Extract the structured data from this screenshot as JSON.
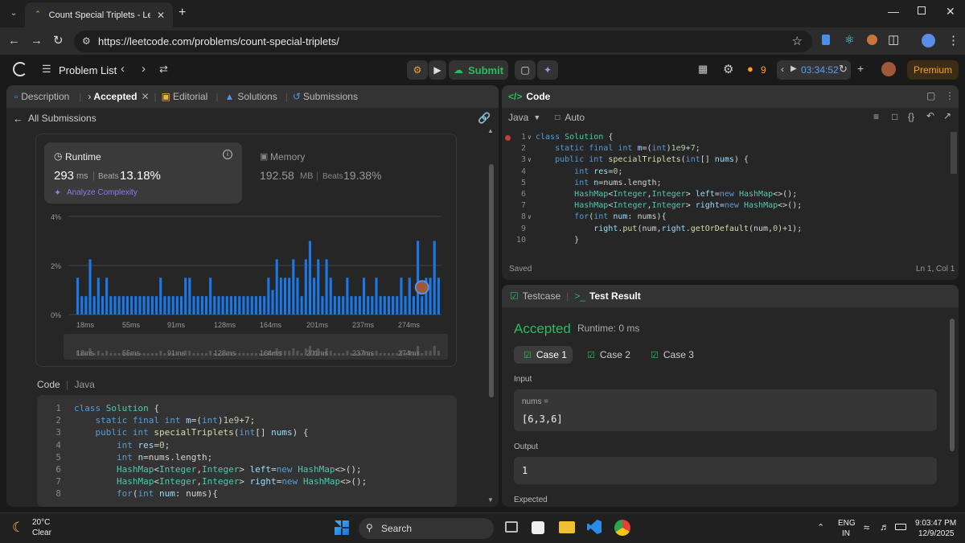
{
  "browser": {
    "tab_title": "Count Special Triplets - LeetCode",
    "url": "https://leetcode.com/problems/count-special-triplets/"
  },
  "nav": {
    "problem_list": "Problem List",
    "submit": "Submit",
    "streak": "9",
    "timer": "03:34:52",
    "premium": "Premium"
  },
  "left": {
    "tabs": [
      "Description",
      "Accepted",
      "Editorial",
      "Solutions",
      "Submissions"
    ],
    "back": "All Submissions",
    "runtime": {
      "label": "Runtime",
      "value": "293",
      "unit": "ms",
      "beats_label": "Beats",
      "beats": "13.18%",
      "analyze": "Analyze Complexity"
    },
    "memory": {
      "label": "Memory",
      "value": "192.58",
      "unit": "MB",
      "beats_label": "Beats",
      "beats": "19.38%"
    },
    "code_label": "Code",
    "lang": "Java"
  },
  "chart_data": {
    "type": "bar",
    "y_ticks": [
      "4%",
      "2%",
      "0%"
    ],
    "x_ticks": [
      "18ms",
      "55ms",
      "91ms",
      "128ms",
      "164ms",
      "201ms",
      "237ms",
      "274ms"
    ],
    "ylim": [
      0,
      4
    ],
    "values": [
      1.5,
      0.75,
      0.75,
      2.25,
      0.75,
      1.5,
      0.75,
      1.5,
      0.75,
      0.75,
      0.75,
      0.75,
      0.75,
      0.75,
      0.75,
      0.75,
      0.75,
      0.75,
      0.75,
      0.75,
      1.5,
      0.75,
      0.75,
      0.75,
      0.75,
      0.75,
      1.5,
      1.5,
      0.75,
      0.75,
      0.75,
      0.75,
      1.5,
      0.75,
      0.75,
      0.75,
      0.75,
      0.75,
      0.75,
      0.75,
      0.75,
      0.75,
      0.75,
      0.75,
      0.75,
      0.75,
      1.5,
      1.0,
      2.25,
      1.5,
      1.5,
      1.5,
      2.25,
      1.5,
      0.75,
      2.25,
      3.0,
      1.5,
      2.25,
      0.75,
      2.25,
      1.5,
      0.75,
      0.75,
      0.75,
      1.5,
      0.75,
      0.75,
      0.75,
      1.5,
      0.75,
      0.75,
      1.5,
      0.75,
      0.75,
      0.75,
      0.75,
      0.75,
      1.5,
      0.75,
      1.5,
      0.75,
      3.0,
      0.75,
      1.5,
      1.5,
      3.0,
      1.5
    ],
    "highlight_index": 83
  },
  "code_lines": [
    [
      [
        "kw",
        "class "
      ],
      [
        "ty",
        "Solution "
      ],
      [
        "tx",
        "{"
      ]
    ],
    [
      [
        "tx",
        "    "
      ],
      [
        "kw",
        "static final int "
      ],
      [
        "va",
        "m"
      ],
      [
        "tx",
        "=("
      ],
      [
        "kw",
        "int"
      ],
      [
        "tx",
        ")"
      ],
      [
        "nm",
        "1e9"
      ],
      [
        "tx",
        "+"
      ],
      [
        "nm",
        "7"
      ],
      [
        "tx",
        ";"
      ]
    ],
    [
      [
        "tx",
        "    "
      ],
      [
        "kw",
        "public int "
      ],
      [
        "fn",
        "specialTriplets"
      ],
      [
        "tx",
        "("
      ],
      [
        "kw",
        "int"
      ],
      [
        "tx",
        "[] "
      ],
      [
        "va",
        "nums"
      ],
      [
        "tx",
        ") {"
      ]
    ],
    [
      [
        "tx",
        "        "
      ],
      [
        "kw",
        "int "
      ],
      [
        "va",
        "res"
      ],
      [
        "tx",
        "="
      ],
      [
        "nm",
        "0"
      ],
      [
        "tx",
        ";"
      ]
    ],
    [
      [
        "tx",
        "        "
      ],
      [
        "kw",
        "int "
      ],
      [
        "va",
        "n"
      ],
      [
        "tx",
        "=nums.length;"
      ]
    ],
    [
      [
        "tx",
        "        "
      ],
      [
        "ty",
        "HashMap"
      ],
      [
        "tx",
        "<"
      ],
      [
        "ty",
        "Integer"
      ],
      [
        "tx",
        ","
      ],
      [
        "ty",
        "Integer"
      ],
      [
        "tx",
        "> "
      ],
      [
        "va",
        "left"
      ],
      [
        "tx",
        "="
      ],
      [
        "kw",
        "new "
      ],
      [
        "ty",
        "HashMap"
      ],
      [
        "tx",
        "<>();"
      ]
    ],
    [
      [
        "tx",
        "        "
      ],
      [
        "ty",
        "HashMap"
      ],
      [
        "tx",
        "<"
      ],
      [
        "ty",
        "Integer"
      ],
      [
        "tx",
        ","
      ],
      [
        "ty",
        "Integer"
      ],
      [
        "tx",
        "> "
      ],
      [
        "va",
        "right"
      ],
      [
        "tx",
        "="
      ],
      [
        "kw",
        "new "
      ],
      [
        "ty",
        "HashMap"
      ],
      [
        "tx",
        "<>();"
      ]
    ],
    [
      [
        "tx",
        "        "
      ],
      [
        "kw",
        "for"
      ],
      [
        "tx",
        "("
      ],
      [
        "kw",
        "int "
      ],
      [
        "va",
        "num"
      ],
      [
        "tx",
        ": nums){"
      ]
    ],
    [
      [
        "tx",
        "            "
      ],
      [
        "va",
        "right"
      ],
      [
        "tx",
        "."
      ],
      [
        "fn",
        "put"
      ],
      [
        "tx",
        "(num,"
      ],
      [
        "va",
        "right"
      ],
      [
        "tx",
        "."
      ],
      [
        "fn",
        "getOrDefault"
      ],
      [
        "tx",
        "(num,"
      ],
      [
        "nm",
        "0"
      ],
      [
        "tx",
        ")+"
      ],
      [
        "nm",
        "1"
      ],
      [
        "tx",
        ");"
      ]
    ],
    [
      [
        "tx",
        "        }"
      ]
    ]
  ],
  "editor": {
    "title": "Code",
    "lang": "Java",
    "auto": "Auto",
    "saved": "Saved",
    "pos": "Ln 1, Col 1"
  },
  "result": {
    "tab1": "Testcase",
    "tab2": "Test Result",
    "status": "Accepted",
    "runtime": "Runtime: 0 ms",
    "cases": [
      "Case 1",
      "Case 2",
      "Case 3"
    ],
    "input_label": "Input",
    "var": "nums =",
    "input_val": "[6,3,6]",
    "output_label": "Output",
    "output_val": "1",
    "expected_label": "Expected"
  },
  "taskbar": {
    "temp": "20°C",
    "weather": "Clear",
    "search": "Search",
    "lang1": "ENG",
    "lang2": "IN",
    "time": "9:03:47 PM",
    "date": "12/9/2025"
  }
}
